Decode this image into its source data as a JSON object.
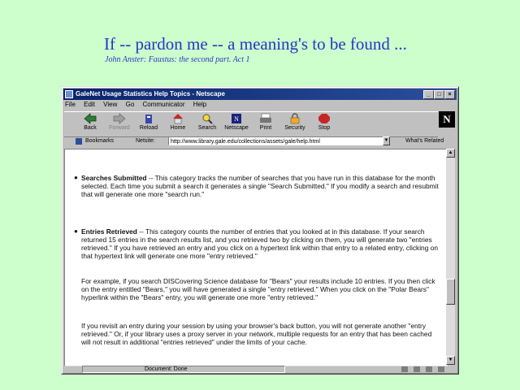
{
  "slide": {
    "title": "If -- pardon me -- a meaning's to be found ...",
    "quote": "John Anster: Faustus: the second part. Act 1"
  },
  "window": {
    "title": "GaleNet Usage Statistics Help Topics - Netscape",
    "controls": {
      "minimize": "_",
      "maximize": "□",
      "close": "×"
    },
    "menu": [
      "File",
      "Edit",
      "View",
      "Go",
      "Communicator",
      "Help"
    ],
    "toolbar": [
      {
        "label": "Back",
        "icon": "back-arrow-icon",
        "enabled": true
      },
      {
        "label": "Forward",
        "icon": "forward-arrow-icon",
        "enabled": false
      },
      {
        "label": "Reload",
        "icon": "reload-icon",
        "enabled": true
      },
      {
        "label": "Home",
        "icon": "home-icon",
        "enabled": true
      },
      {
        "label": "Search",
        "icon": "search-icon",
        "enabled": true
      },
      {
        "label": "Netscape",
        "icon": "netscape-icon",
        "enabled": true
      },
      {
        "label": "Print",
        "icon": "print-icon",
        "enabled": true
      },
      {
        "label": "Security",
        "icon": "security-lock-icon",
        "enabled": true
      },
      {
        "label": "Stop",
        "icon": "stop-icon",
        "enabled": true
      }
    ],
    "logo": "N",
    "location_bar": {
      "bookmarks_label": "Bookmarks",
      "location_label": "Netsite:",
      "url": "http://www.library.gale.edu/collections/assets/gale/help.html",
      "related_label": "What's Related"
    },
    "status_text": "Document: Done"
  },
  "content": {
    "entries": [
      {
        "term": "Searches Submitted",
        "text": " -- This category tracks the number of searches that you have run in this database for the month selected. Each time you submit a search it generates a single \"Search Submitted.\" If you modify a search and resubmit that will generate one more \"search run.\""
      },
      {
        "term": "Entries Retrieved",
        "text": " -- This category counts the number of entries that you looked at in this database. If your search returned 15 entries in the search results list, and you retrieved two by clicking on them, you will generate two \"entries retrieved.\" If you have retrieved an entry and you click on a hypertext link within that entry to a related entry, clicking on that hypertext link will generate one more \"entry retrieved.\""
      }
    ],
    "example": "For example, if you search DISCovering Science database for \"Bears\" your results include 10 entries. If you then click on the entry entitled \"Bears,\" you will have generated a single \"entry retrieved.\" When you click on the \"Polar Bears\" hyperlink within the \"Bears\" entry, you will generate one more \"entry retrieved.\"",
    "revisit": "If you revisit an entry during your session by using your browser's back button, you will not generate another \"entry retrieved.\" Or, if your library uses a proxy server in your network, multiple requests for an entry that has been cached will not result in additional \"entries retrieved\" under the limits of your cache."
  },
  "colors": {
    "background": "#ccffcc",
    "title_blue": "#2a35c8",
    "titlebar": "#0a246a"
  }
}
